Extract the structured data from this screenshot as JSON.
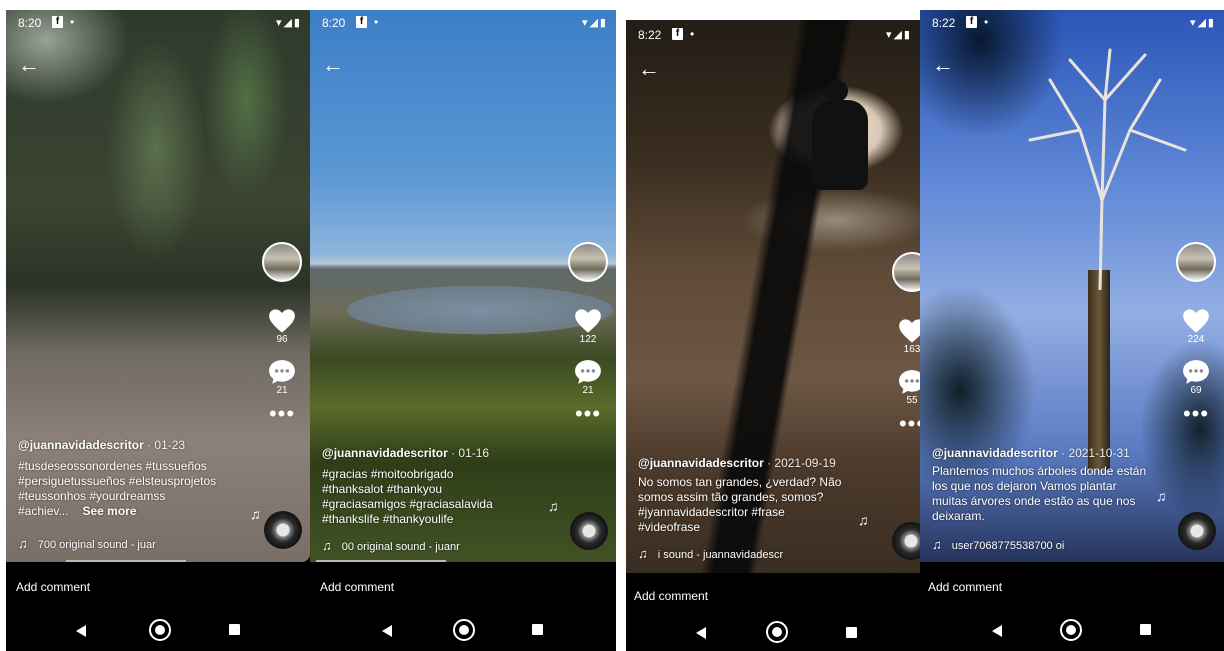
{
  "panels": [
    {
      "status_time": "8:20",
      "fb": "f",
      "dot": "•",
      "likes": "96",
      "comments": "21",
      "user": "@juannavidadescritor",
      "date": " · 01-23",
      "caption": "#tusdeseossonordenes #tussueños #persiguetussueños #elsteusprojetos #teussonhos #yourdreamss #achiev...",
      "see_more": "See more",
      "sound": "700   original sound - juar",
      "add_comment": "Add comment"
    },
    {
      "status_time": "8:20",
      "fb": "f",
      "dot": "•",
      "likes": "122",
      "comments": "21",
      "user": "@juannavidadescritor",
      "date": " · 01-16",
      "caption": "#gracias #moitoobrigado #thanksalot #thankyou #graciasamigos #graciasalavida #thankslife #thankyoulife",
      "sound": "00   original sound - juanr",
      "add_comment": "Add comment"
    },
    {
      "status_time": "8:22",
      "fb": "f",
      "dot": "•",
      "likes": "163",
      "comments": "55",
      "user": "@juannavidadescritor",
      "date": " · 2021-09-19",
      "caption": "No somos tan grandes, ¿verdad? Não somos assim tão grandes, somos?          #jyannavidadescritor #frase #videofrase",
      "sound": "i sound - juannavidadescr",
      "add_comment": "Add comment"
    },
    {
      "status_time": "8:22",
      "fb": "f",
      "dot": "•",
      "likes": "224",
      "comments": "69",
      "user": "@juannavidadescritor",
      "date": " · 2021-10-31",
      "caption": "Plantemos muchos árboles donde están los que nos dejaron Vamos plantar muitas árvores onde estão as que nos deixaram.",
      "sound": "user7068775538700   oi",
      "add_comment": "Add comment"
    }
  ],
  "icons": {
    "back": "←",
    "music": "♫",
    "more": "•••",
    "sys": "▾◢▮"
  }
}
